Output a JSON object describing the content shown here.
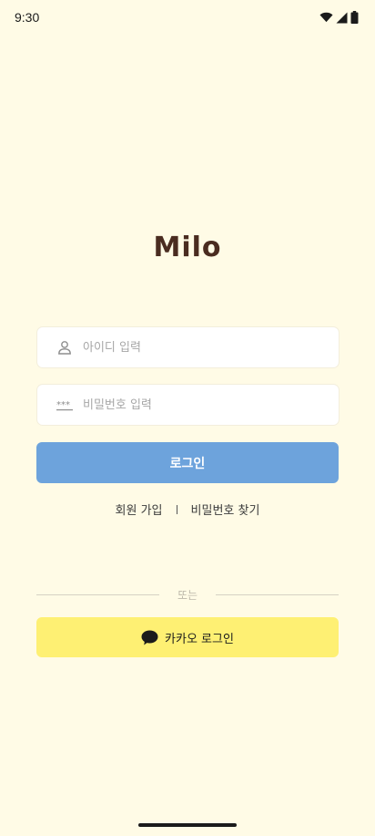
{
  "status_bar": {
    "time": "9:30"
  },
  "app": {
    "logo": "Milo"
  },
  "form": {
    "id_placeholder": "아이디 입력",
    "password_placeholder": "비밀번호 입력",
    "login_label": "로그인"
  },
  "links": {
    "signup": "회원 가입",
    "find_password": "비밀번호 찾기"
  },
  "divider": {
    "text": "또는"
  },
  "kakao": {
    "label": "카카오 로그인"
  },
  "colors": {
    "background": "#FFFBE6",
    "login_button": "#6DA3DC",
    "kakao_button": "#FEF073",
    "logo": "#4A2C20"
  },
  "icons": {
    "id_field": "user-icon",
    "password_field": "password-dots-icon",
    "kakao": "speech-bubble-icon"
  }
}
